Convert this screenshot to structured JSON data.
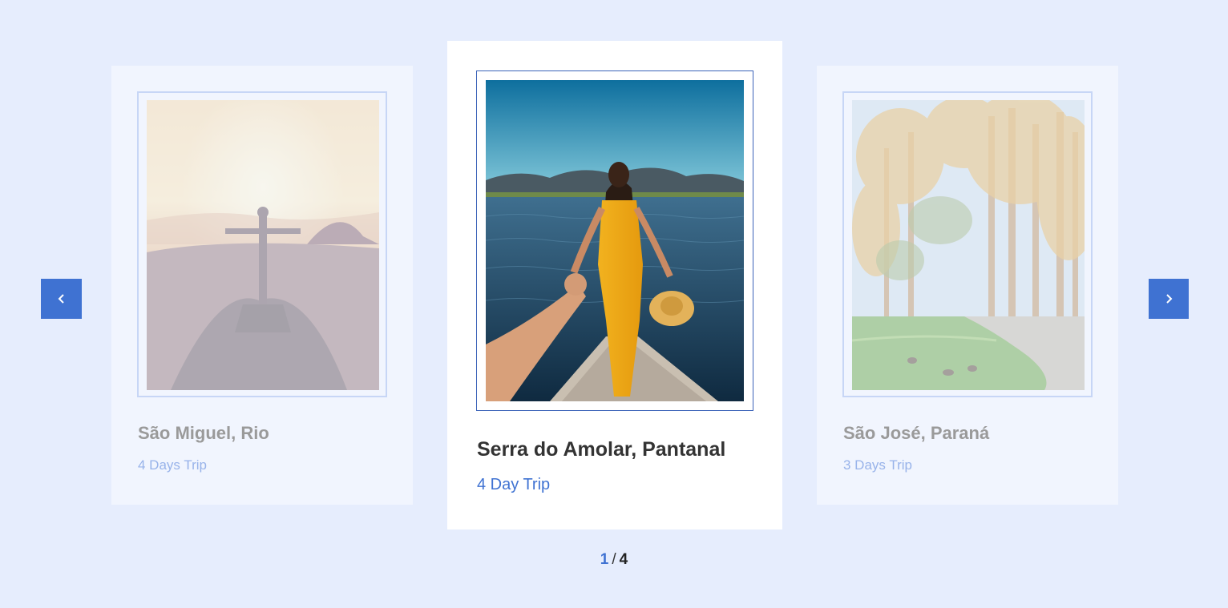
{
  "carousel": {
    "prev_icon": "chevron-left-icon",
    "next_icon": "chevron-right-icon",
    "pager": {
      "current": "1",
      "separator": "/",
      "total": "4"
    },
    "slides": [
      {
        "title": "São Miguel, Rio",
        "subtitle": "4 Days Trip",
        "image": "christ-the-redeemer-sunrise-photo"
      },
      {
        "title": "Serra do Amolar, Pantanal",
        "subtitle": "4 Day Trip",
        "image": "woman-on-boat-lake-photo"
      },
      {
        "title": "São José, Paraná",
        "subtitle": "3 Days Trip",
        "image": "park-trees-path-photo"
      }
    ]
  },
  "colors": {
    "background": "#e6edfd",
    "accent": "#3f72d2",
    "title": "#333333"
  }
}
